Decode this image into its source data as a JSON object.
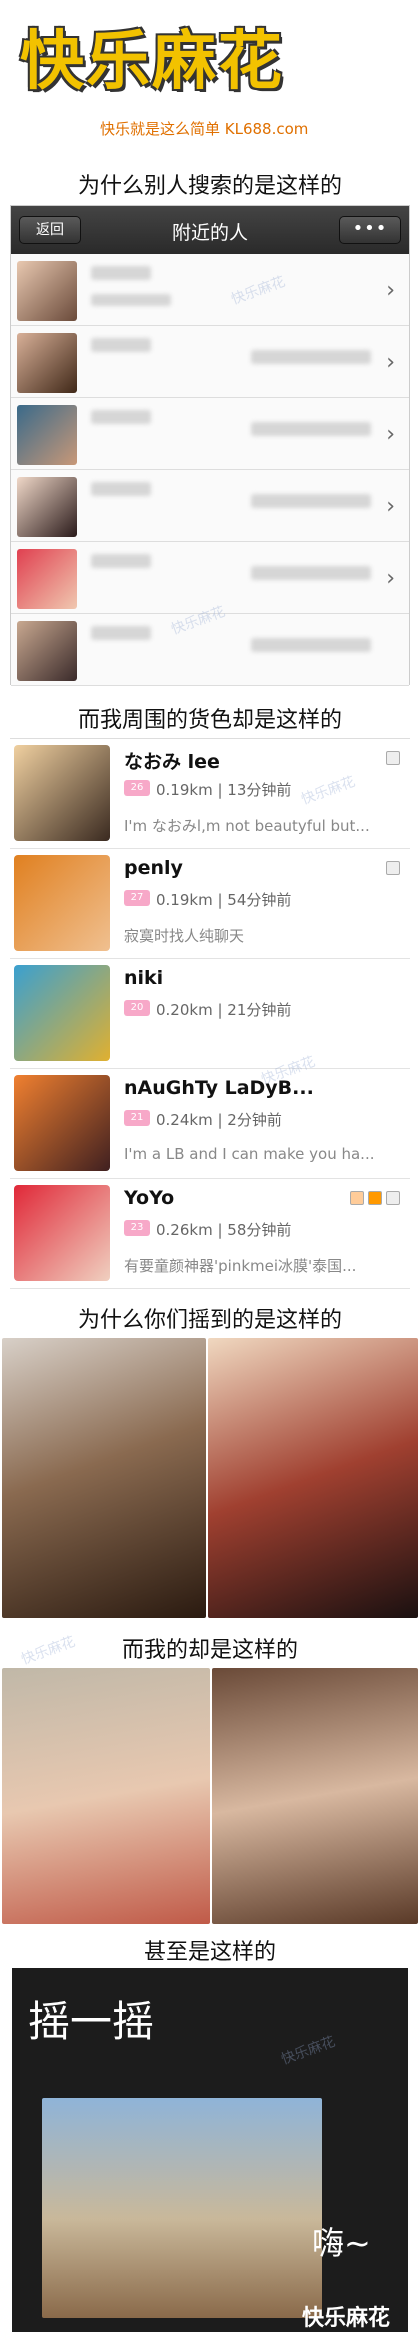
{
  "logo": {
    "title": "快乐麻花",
    "tagline": "快乐就是这么简单 KL688.com"
  },
  "captions": [
    "为什么别人搜索的是这样的",
    "而我周围的货色却是这样的",
    "为什么你们摇到的是这样的",
    "而我的却是这样的",
    "甚至是这样的"
  ],
  "ios": {
    "back": "返回",
    "title": "附近的人",
    "menu": "•••"
  },
  "nearby_list": [
    {
      "name": "なおみ lee",
      "badge": "26",
      "meta": "0.19km | 13分钟前",
      "msg": "I'm なおみl,m not beautyful but..."
    },
    {
      "name": "penly",
      "badge": "27",
      "meta": "0.19km | 54分钟前",
      "msg": "寂寞时找人纯聊天"
    },
    {
      "name": "niki",
      "badge": "20",
      "meta": "0.20km | 21分钟前",
      "msg": ""
    },
    {
      "name": "nAuGhTy LaDyB...",
      "badge": "21",
      "meta": "0.24km | 2分钟前",
      "msg": "I'm a LB and I can make you ha..."
    },
    {
      "name": "YoYo",
      "badge": "23",
      "meta": "0.26km | 58分钟前",
      "msg": "有要童颜神器'pinkmei冰膜'泰国..."
    }
  ],
  "shake": {
    "title": "摇一摇",
    "exclaim": "嗨~",
    "footer": "快乐麻花"
  },
  "watermark": "快乐麻花",
  "colors": {
    "accent": "#f2c200",
    "badge": "#f7a8c8",
    "bar": "#333333"
  },
  "icons": [
    "chevron-right-icon",
    "female-icon"
  ]
}
